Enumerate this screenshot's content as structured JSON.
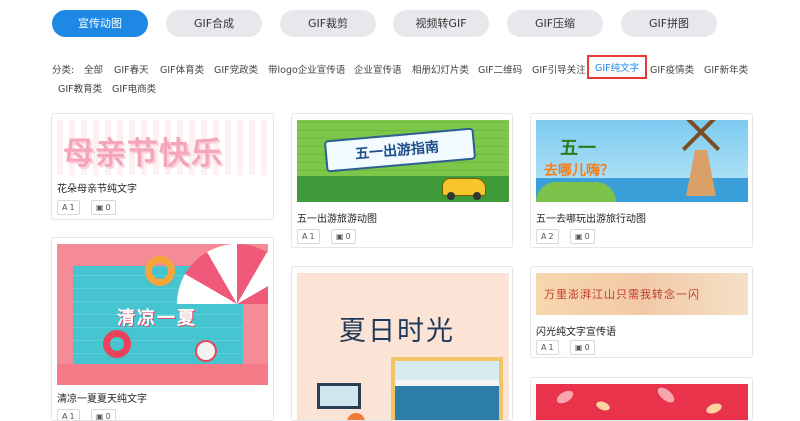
{
  "tabs": [
    {
      "label": "宣传动图",
      "active": true
    },
    {
      "label": "GIF合成"
    },
    {
      "label": "GIF裁剪"
    },
    {
      "label": "视频转GIF"
    },
    {
      "label": "GIF压缩"
    },
    {
      "label": "GIF拼图"
    }
  ],
  "categories": {
    "label": "分类:",
    "items": [
      "全部",
      "GIF春天",
      "GIF体育类",
      "GIF党政类",
      "带logo企业宣传语",
      "企业宣传语",
      "相册幻灯片类",
      "GIF二维码",
      "GIF引导关注",
      "GIF纯文字",
      "GIF疫情类",
      "GIF新年类",
      "GIF教育类",
      "GIF电商类"
    ],
    "selected": "GIF纯文字"
  },
  "cards": [
    {
      "title": "花朵母亲节纯文字",
      "text_count": "1",
      "image_count": "0",
      "thumb_text": "母亲节快乐"
    },
    {
      "title": "五一出游旅游动图",
      "text_count": "1",
      "image_count": "0",
      "thumb_text": "五一出游指南"
    },
    {
      "title": "五一去哪玩出游旅行动图",
      "text_count": "2",
      "image_count": "0",
      "thumb_text_1": "五一",
      "thumb_text_2": "去哪儿嗨？"
    },
    {
      "title": "清凉一夏夏天纯文字",
      "text_count": "1",
      "image_count": "0",
      "thumb_text": "清凉一夏"
    },
    {
      "title": "",
      "thumb_text": "夏日时光"
    },
    {
      "title": "闪光纯文字宣传语",
      "text_count": "1",
      "image_count": "0",
      "thumb_text": "万里澎湃江山只需我转念一闪"
    },
    {
      "title": ""
    }
  ],
  "icons": {
    "text": "A",
    "image": "image-icon"
  },
  "colors": {
    "accent": "#1e88e5",
    "selected_border": "#e53935"
  }
}
